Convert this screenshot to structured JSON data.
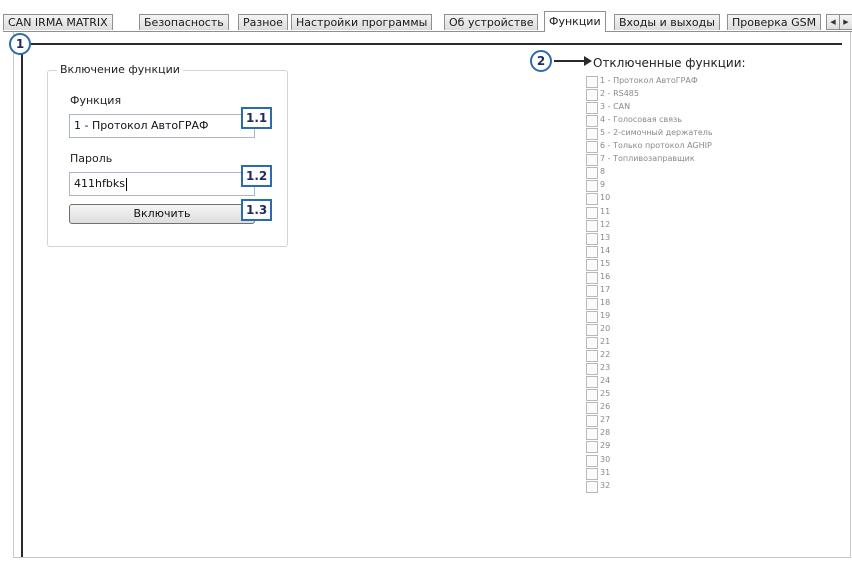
{
  "tabs": [
    {
      "label": "CAN IRMA MATRIX",
      "active": false
    },
    {
      "label": "Безопасность",
      "active": false
    },
    {
      "label": "Разное",
      "active": false
    },
    {
      "label": "Настройки программы",
      "active": false
    },
    {
      "label": "Об устройстве",
      "active": false
    },
    {
      "label": "Функции",
      "active": true
    },
    {
      "label": "Входы и выходы",
      "active": false
    },
    {
      "label": "Проверка GSM",
      "active": false
    }
  ],
  "tab_scroll": {
    "left_icon": "chevron-left-icon",
    "right_icon": "chevron-right-icon"
  },
  "callouts": {
    "c1": "1",
    "c2": "2",
    "c1_1": "1.1",
    "c1_2": "1.2",
    "c1_3": "1.3"
  },
  "enable_group": {
    "title": "Включение функции",
    "function_label": "Функция",
    "function_value": "1 - Протокол АвтоГРАФ",
    "password_label": "Пароль",
    "password_value": "411hfbks",
    "enable_button": "Включить"
  },
  "disabled_functions": {
    "title": "Отключенные функции:",
    "items": [
      "1 - Протокол АвтоГРАФ",
      "2 - RS485",
      "3 - CAN",
      "4 - Голосовая связь",
      "5 - 2-симочный держатель",
      "6 - Только протокол AGHIP",
      "7 - Топливозаправщик",
      "8",
      "9",
      "10",
      "11",
      "12",
      "13",
      "14",
      "15",
      "16",
      "17",
      "18",
      "19",
      "20",
      "21",
      "22",
      "23",
      "24",
      "25",
      "26",
      "27",
      "28",
      "29",
      "30",
      "31",
      "32"
    ]
  },
  "colors": {
    "callout_border": "#2b6cb0",
    "callout_text": "#1f2d5a"
  }
}
